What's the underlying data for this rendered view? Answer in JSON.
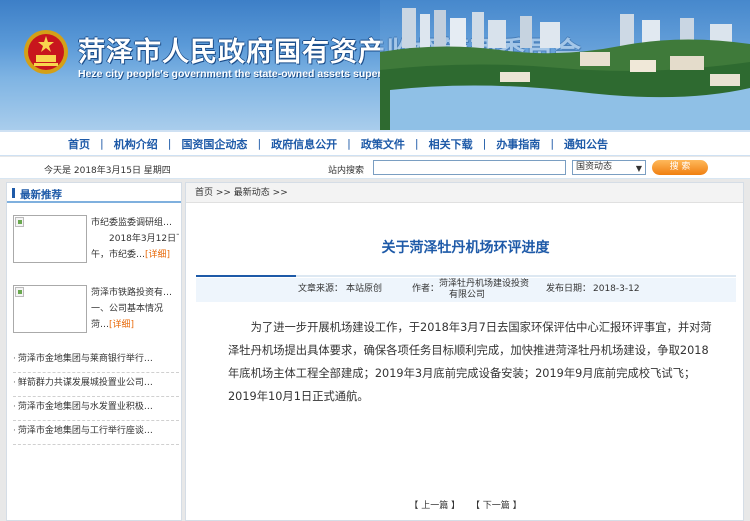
{
  "banner": {
    "title_cn": "菏泽市人民政府国有资产监督管理委员会",
    "title_en": "Heze city people's government the state-owned assets supervision and administration commission"
  },
  "nav": {
    "items": [
      "首页",
      "机构介绍",
      "国资国企动态",
      "政府信息公开",
      "政策文件",
      "相关下载",
      "办事指南",
      "通知公告"
    ],
    "separator": "|"
  },
  "infobar": {
    "date": "今天是  2018年3月15日  星期四",
    "search_label": "站内搜索",
    "search_value": "",
    "select_value": "国资动态",
    "search_button": "搜 索"
  },
  "sidebar": {
    "heading": "最新推荐",
    "featured": [
      {
        "lines": [
          "市纪委监委调研组…",
          "2018年3月12日下",
          "午，市纪委…"
        ],
        "more": "[详细]"
      },
      {
        "lines": [
          "菏泽市铁路投资有…",
          "一、公司基本情况",
          "菏…"
        ],
        "more": "[详细]"
      }
    ],
    "list": [
      "菏泽市金地集团与莱商银行举行…",
      "鲜箭群力共谋发展城投置业公司…",
      "菏泽市金地集团与水发置业积极…",
      "菏泽市金地集团与工行举行座谈…"
    ]
  },
  "main": {
    "breadcrumb": "首页 >> 最新动态 >>",
    "title": "关于菏泽牡丹机场环评进度",
    "meta": {
      "source_label": "文章来源：",
      "source_value": "本站原创",
      "author_label": "作者：",
      "author_value_1": "菏泽牡丹机场建设投资",
      "author_value_2": "有限公司",
      "date_label": "发布日期：",
      "date_value": "2018-3-12"
    },
    "body": "为了进一步开展机场建设工作，于2018年3月7日去国家环保评估中心汇报环评事宜，并对菏泽牡丹机场提出具体要求，确保各项任务目标顺利完成，加快推进菏泽牡丹机场建设，争取2018年底机场主体工程全部建成；2019年3月底前完成设备安装；2019年9月底前完成校飞试飞；2019年10月1日正式通航。",
    "pager": {
      "prev": "【 上一篇 】",
      "next": "【 下一篇 】"
    }
  }
}
